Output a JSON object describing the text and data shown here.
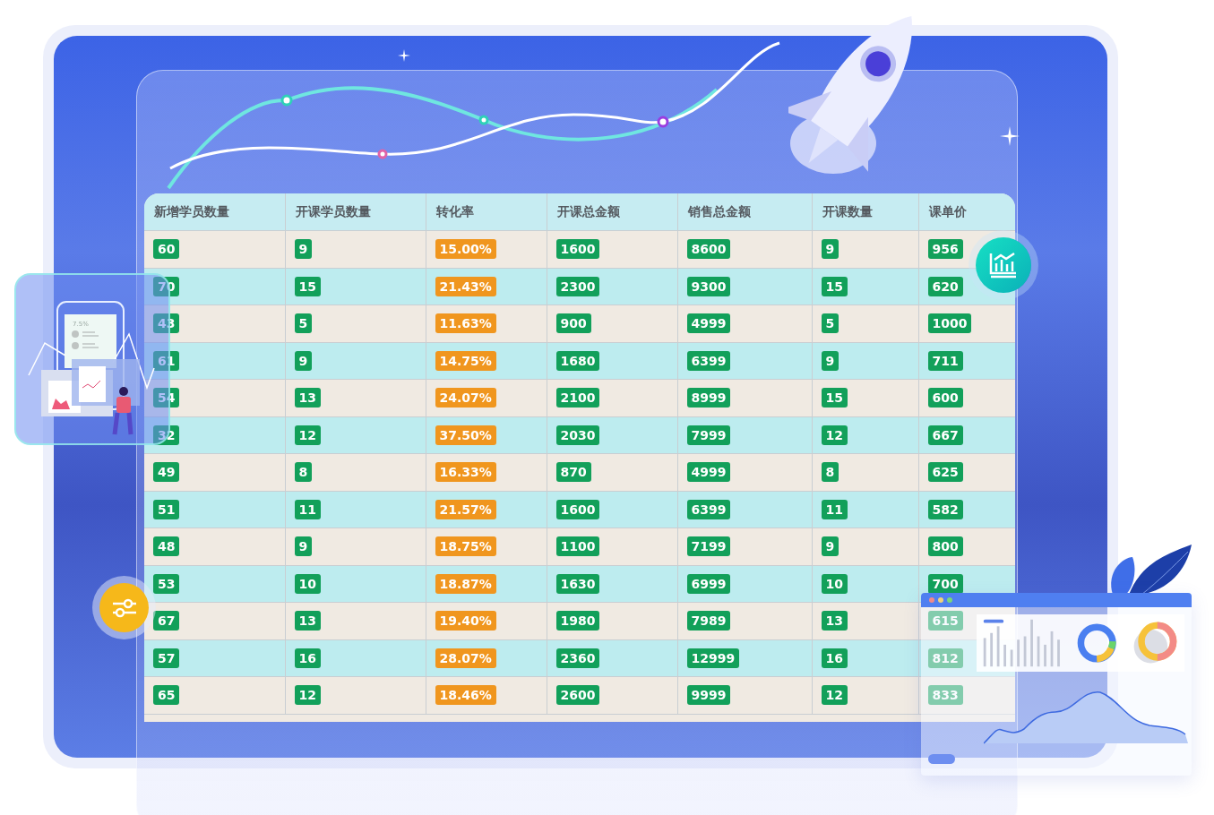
{
  "table": {
    "columns": [
      {
        "label": "新增学员数量",
        "color": "#12a05a"
      },
      {
        "label": "开课学员数量",
        "color": "#12a05a"
      },
      {
        "label": "转化率",
        "color": "#f0961e"
      },
      {
        "label": "开课总金额",
        "color": "#12a05a"
      },
      {
        "label": "销售总金额",
        "color": "#12a05a"
      },
      {
        "label": "开课数量",
        "color": "#12a05a"
      },
      {
        "label": "课单价",
        "color": "#12a05a"
      }
    ],
    "rows": [
      [
        "60",
        "9",
        "15.00%",
        "1600",
        "8600",
        "9",
        "956"
      ],
      [
        "70",
        "15",
        "21.43%",
        "2300",
        "9300",
        "15",
        "620"
      ],
      [
        "43",
        "5",
        "11.63%",
        "900",
        "4999",
        "5",
        "1000"
      ],
      [
        "61",
        "9",
        "14.75%",
        "1680",
        "6399",
        "9",
        "711"
      ],
      [
        "54",
        "13",
        "24.07%",
        "2100",
        "8999",
        "15",
        "600"
      ],
      [
        "32",
        "12",
        "37.50%",
        "2030",
        "7999",
        "12",
        "667"
      ],
      [
        "49",
        "8",
        "16.33%",
        "870",
        "4999",
        "8",
        "625"
      ],
      [
        "51",
        "11",
        "21.57%",
        "1600",
        "6399",
        "11",
        "582"
      ],
      [
        "48",
        "9",
        "18.75%",
        "1100",
        "7199",
        "9",
        "800"
      ],
      [
        "53",
        "10",
        "18.87%",
        "1630",
        "6999",
        "10",
        "700"
      ],
      [
        "67",
        "13",
        "19.40%",
        "1980",
        "7989",
        "13",
        "615"
      ],
      [
        "57",
        "16",
        "28.07%",
        "2360",
        "12999",
        "16",
        "812"
      ],
      [
        "65",
        "12",
        "18.46%",
        "2600",
        "9999",
        "12",
        "833"
      ]
    ]
  },
  "phone_card": {
    "percent": "7.5%"
  }
}
